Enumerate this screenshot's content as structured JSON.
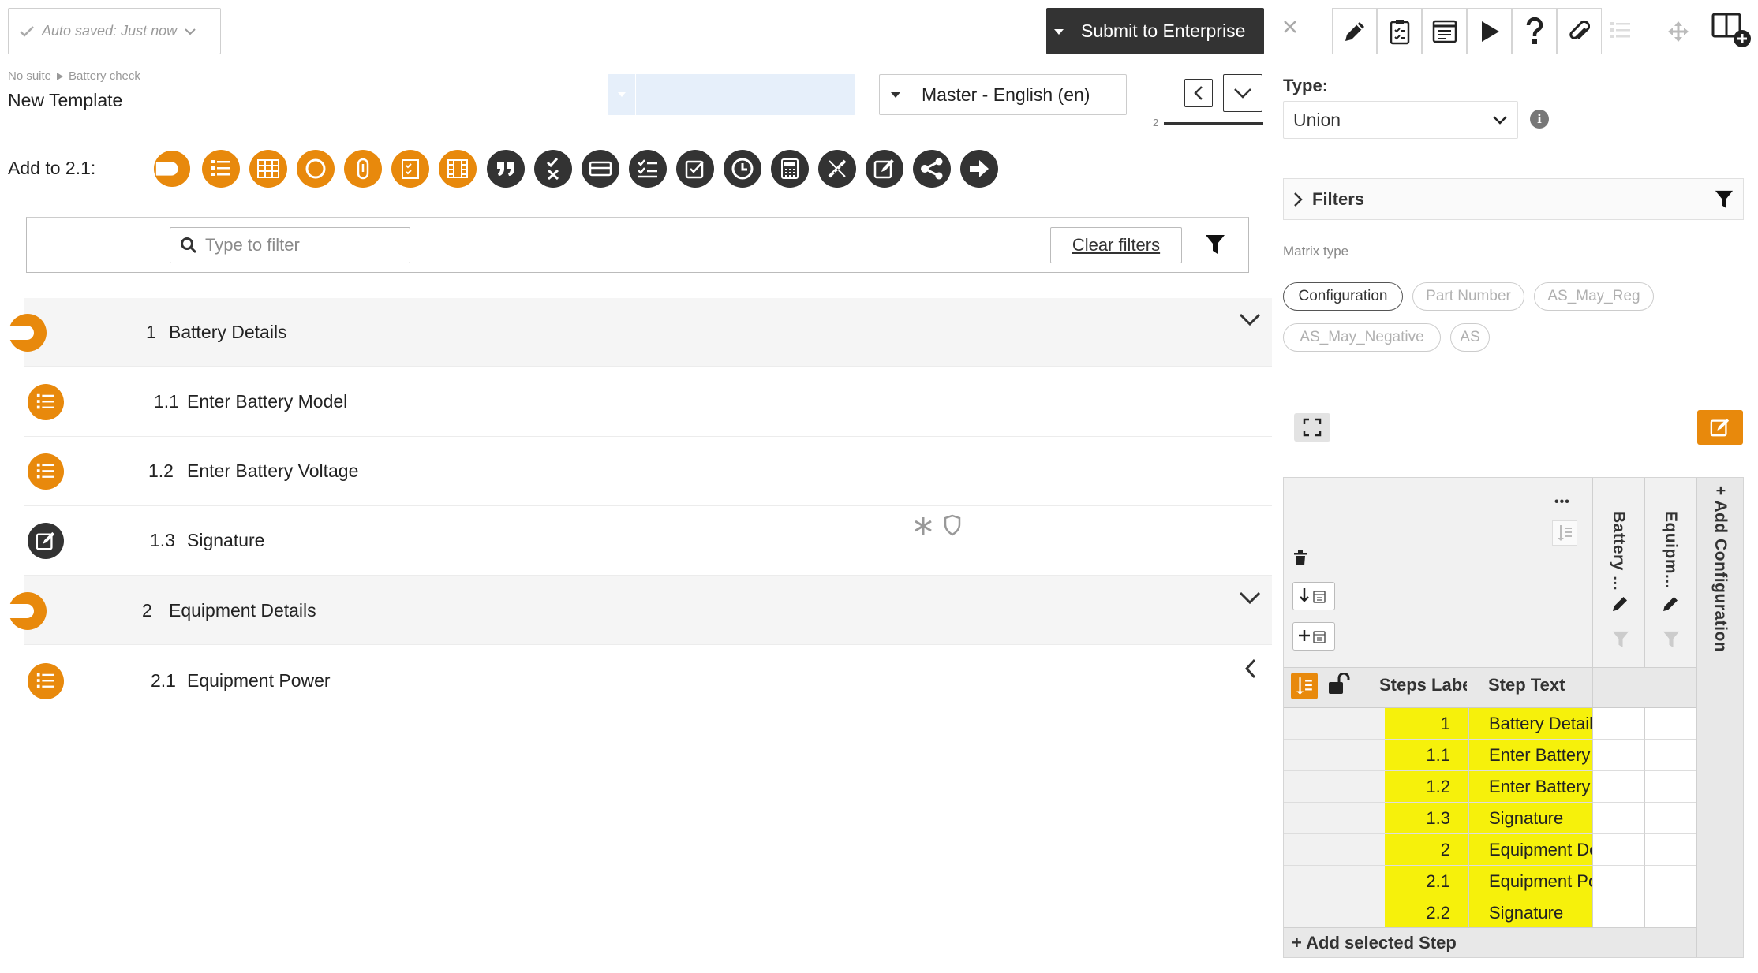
{
  "autosave": {
    "label": "Auto saved: Just now"
  },
  "submit": {
    "label": "Submit to Enterprise"
  },
  "breadcrumb": {
    "suite": "No suite",
    "item": "Battery check"
  },
  "template": {
    "title": "New Template"
  },
  "language": {
    "selected": "Master - English (en)"
  },
  "nav": {
    "step_index": "2"
  },
  "toolbar": {
    "add_to_label": "Add to 2.1:"
  },
  "filter": {
    "placeholder": "Type to filter",
    "clear_label": "Clear filters"
  },
  "steps": [
    {
      "num": "1",
      "label": "Battery Details",
      "type": "section"
    },
    {
      "num": "1.1",
      "label": "Enter Battery Model",
      "type": "list"
    },
    {
      "num": "1.2",
      "label": "Enter Battery Voltage",
      "type": "list"
    },
    {
      "num": "1.3",
      "label": "Signature",
      "type": "signature"
    },
    {
      "num": "2",
      "label": "Equipment Details",
      "type": "section"
    },
    {
      "num": "2.1",
      "label": "Equipment Power",
      "type": "list"
    }
  ],
  "right": {
    "type_label": "Type:",
    "type_value": "Union",
    "filters_label": "Filters",
    "matrix_type_label": "Matrix type",
    "chips": [
      "Configuration",
      "Part Number",
      "AS_May_Reg",
      "AS_May_Negative",
      "AS"
    ],
    "active_chip": "Configuration",
    "matrix": {
      "columns": [
        "Battery ...",
        "Equipm..."
      ],
      "add_config": "+ Add Configuration",
      "col_steps_label": "Steps Label",
      "col_step_text": "Step Text",
      "rows": [
        {
          "label": "1",
          "text": "Battery Details"
        },
        {
          "label": "1.1",
          "text": "Enter Battery Model"
        },
        {
          "label": "1.2",
          "text": "Enter Battery Voltage"
        },
        {
          "label": "1.3",
          "text": "Signature"
        },
        {
          "label": "2",
          "text": "Equipment Details"
        },
        {
          "label": "2.1",
          "text": "Equipment Power"
        },
        {
          "label": "2.2",
          "text": "Signature"
        }
      ],
      "add_step": "+ Add selected Step",
      "more_icon": "•••"
    }
  },
  "colors": {
    "accent": "#e8890c",
    "dark": "#333333",
    "highlight": "#f6f10b"
  }
}
